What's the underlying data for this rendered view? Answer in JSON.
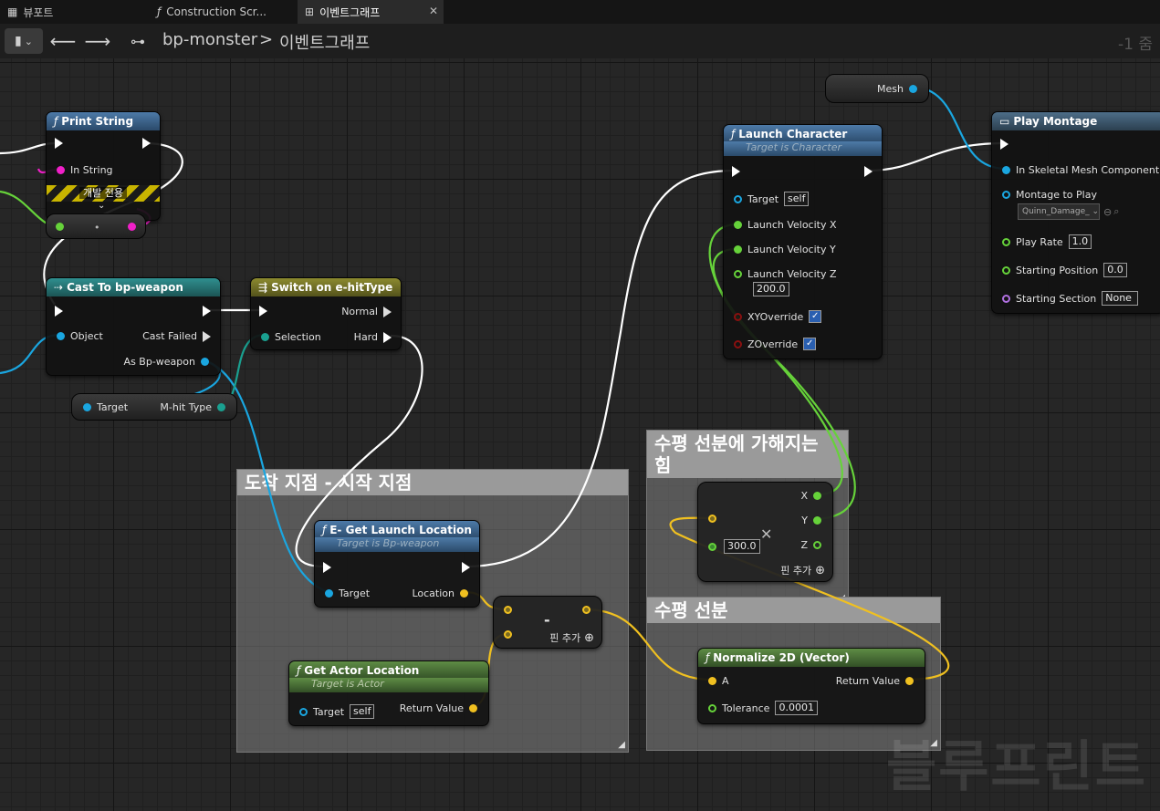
{
  "tabs": [
    {
      "label": "뷰포트",
      "icon": "grid-icon"
    },
    {
      "label": "Construction Scr...",
      "icon": "function-icon"
    },
    {
      "label": "이벤트그래프",
      "icon": "graph-icon"
    }
  ],
  "breadcrumb": {
    "blueprint": "bp-monster",
    "separator": ">",
    "graph": "이벤트그래프"
  },
  "zoom": "-1 줌",
  "watermark": "블루프린트",
  "comments": {
    "c1": "도착 지점 - 시작 지점",
    "c2": "수평 선분에 가해지는 힘",
    "c3": "수평 선분"
  },
  "nodes": {
    "print_string": {
      "title": "Print String",
      "in_string": "In String",
      "dev_only": "개발 전용"
    },
    "cast": {
      "title": "Cast To bp-weapon",
      "object": "Object",
      "cast_failed": "Cast Failed",
      "as": "As Bp-weapon"
    },
    "target_var": {
      "target": "Target",
      "mhit": "M-hit Type"
    },
    "switch": {
      "title": "Switch on e-hitType",
      "normal": "Normal",
      "selection": "Selection",
      "hard": "Hard"
    },
    "launch_char": {
      "title": "Launch Character",
      "subtitle": "Target is Character",
      "target": "Target",
      "target_val": "self",
      "lvx": "Launch Velocity X",
      "lvy": "Launch Velocity Y",
      "lvz": "Launch Velocity Z",
      "lvz_val": "200.0",
      "xyo": "XYOverride",
      "zo": "ZOverride"
    },
    "mesh_var": {
      "label": "Mesh"
    },
    "play_montage": {
      "title": "Play Montage",
      "skel": "In Skeletal Mesh Component",
      "montage": "Montage to Play",
      "montage_val": "Quinn_Damage_",
      "rate": "Play Rate",
      "rate_val": "1.0",
      "start_pos": "Starting Position",
      "start_pos_val": "0.0",
      "start_sec": "Starting Section",
      "start_sec_val": "None"
    },
    "multiply": {
      "x": "X",
      "y": "Y",
      "z": "Z",
      "val": "300.0",
      "add_pin": "핀 추가"
    },
    "get_launch": {
      "title": "E- Get Launch Location",
      "subtitle": "Target is Bp-weapon",
      "target": "Target",
      "location": "Location"
    },
    "subtract": {
      "symbol": "-",
      "add_pin": "핀 추가"
    },
    "get_actor": {
      "title": "Get Actor Location",
      "subtitle": "Target is Actor",
      "target": "Target",
      "target_val": "self",
      "ret": "Return Value"
    },
    "normalize": {
      "title": "Normalize 2D (Vector)",
      "a": "A",
      "ret": "Return Value",
      "tol": "Tolerance",
      "tol_val": "0.0001"
    }
  },
  "colors": {
    "exec": "#ffffff",
    "object": "#1aa6e0",
    "float": "#66d23a",
    "vector": "#f0c020",
    "string": "#f020c8",
    "bool": "#8a1010",
    "byte": "#1aa090",
    "name": "#b070e0"
  }
}
